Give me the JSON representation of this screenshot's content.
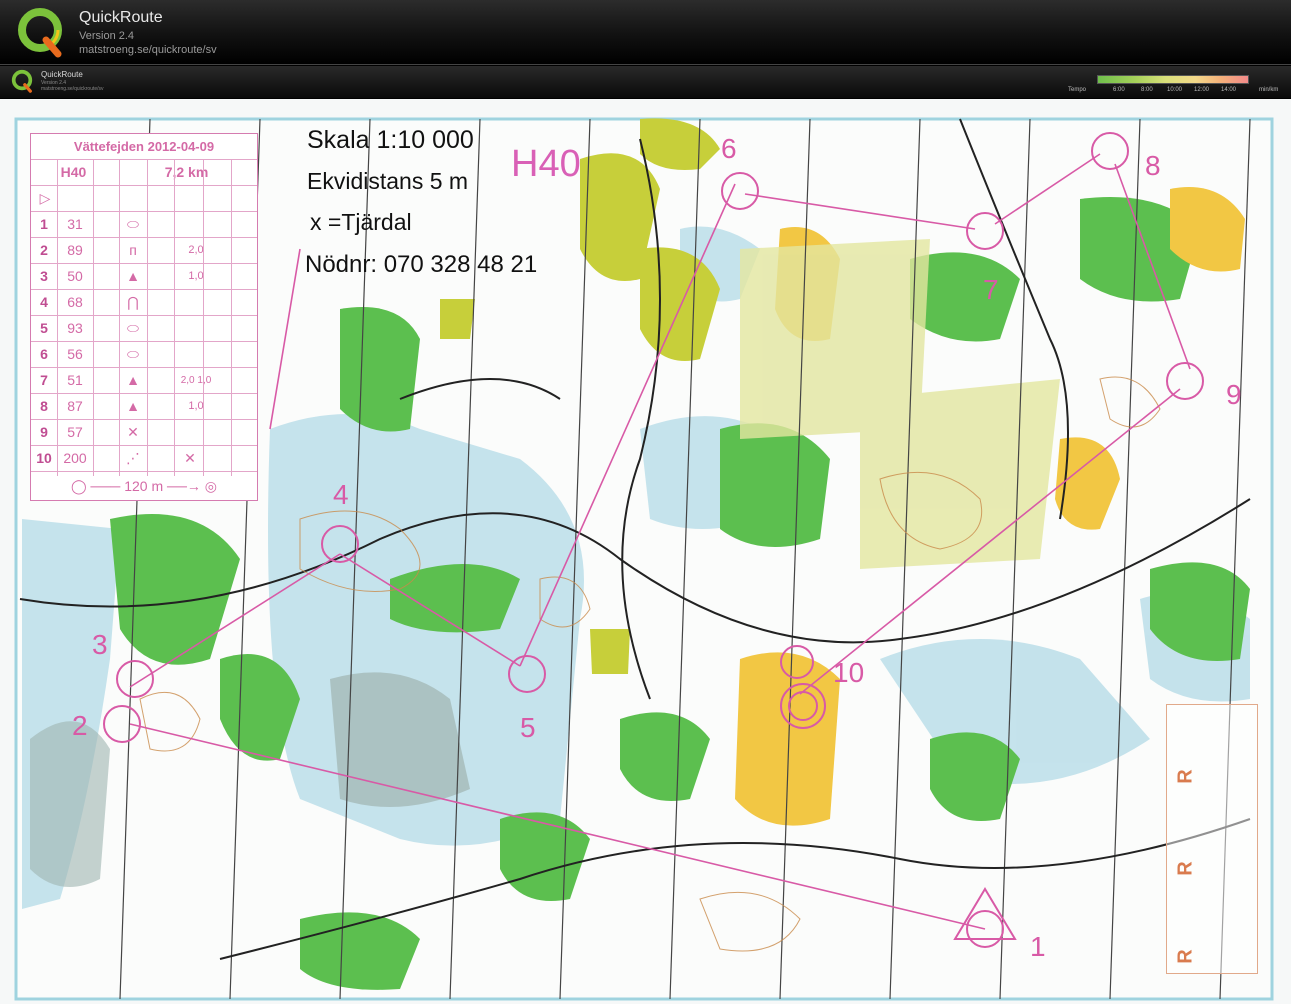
{
  "app": {
    "title": "QuickRoute",
    "version": "Version 2.4",
    "url": "matstroeng.se/quickroute/sv"
  },
  "map_header": {
    "title": "QuickRoute",
    "version": "Version 2.4",
    "url": "matstroeng.se/quickroute/sv",
    "legend_label": "Tempo",
    "legend_ticks": [
      "6:00",
      "8:00",
      "10:00",
      "12:00",
      "14:00"
    ],
    "legend_unit": "min/km"
  },
  "map": {
    "scale_text": "Skala 1:10 000",
    "contour_text": "Ekvidistans 5 m",
    "x_note": "x =Tjärdal",
    "emergency_text": "Nödnr: 070 328 48 21",
    "class_label": "H40",
    "control_numbers": [
      "1",
      "2",
      "3",
      "4",
      "5",
      "6",
      "7",
      "8",
      "9",
      "10"
    ],
    "r_labels": [
      "R",
      "R",
      "R"
    ]
  },
  "description_sheet": {
    "event": "Vättefejden 2012-04-09",
    "class": "H40",
    "length": "7,2 km",
    "rows": [
      {
        "num": "1",
        "code": "31",
        "extra": ""
      },
      {
        "num": "2",
        "code": "89",
        "extra": "2,0"
      },
      {
        "num": "3",
        "code": "50",
        "extra": "1,0"
      },
      {
        "num": "4",
        "code": "68",
        "extra": ""
      },
      {
        "num": "5",
        "code": "93",
        "extra": ""
      },
      {
        "num": "6",
        "code": "56",
        "extra": ""
      },
      {
        "num": "7",
        "code": "51",
        "extra": "2,0 1,0"
      },
      {
        "num": "8",
        "code": "87",
        "extra": "1,0"
      },
      {
        "num": "9",
        "code": "57",
        "extra": ""
      },
      {
        "num": "10",
        "code": "200",
        "extra": ""
      }
    ],
    "finish_text": "120 m"
  },
  "colors": {
    "course": "#d85aa6",
    "forest_green": "#5cbf4f",
    "yellow_open": "#f2c744",
    "water_blue": "#b8dce8"
  }
}
